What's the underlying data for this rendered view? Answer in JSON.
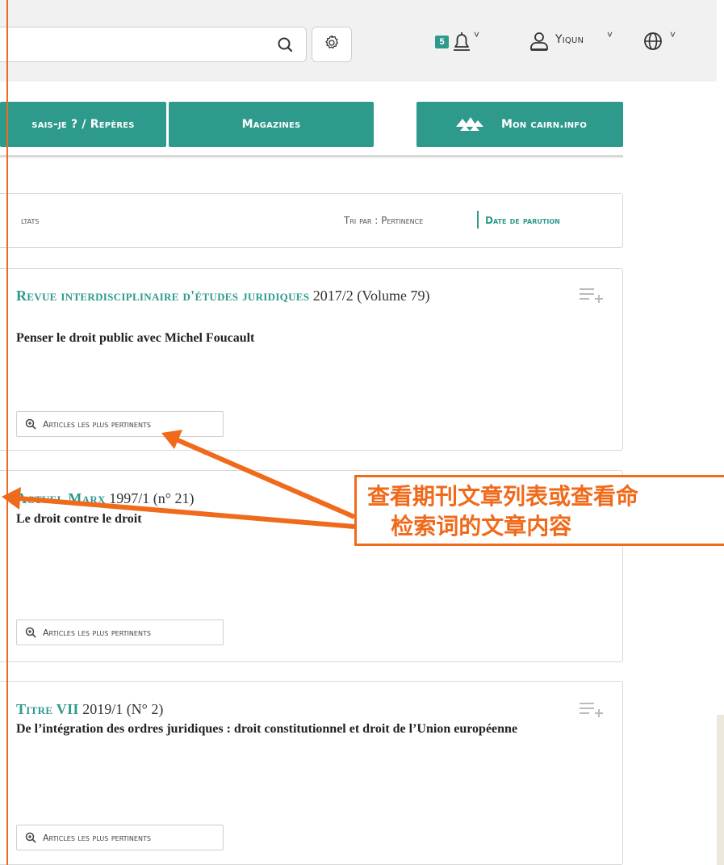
{
  "header": {
    "notification_count": "5",
    "user_name": "Yiqun"
  },
  "nav": {
    "btn1": "sais-je ? / Repères",
    "btn2": "Magazines",
    "btn3": "Mon cairn.info"
  },
  "results_bar": {
    "results_label": "ltats",
    "sort_prefix": "Tri par : Pertinence",
    "sort_date": "Date de parution"
  },
  "cards": [
    {
      "journal": "Revue interdisciplinaire d'études juridiques",
      "issue": "2017/2 (Volume 79)",
      "title": "Penser le droit public avec Michel Foucault",
      "button": "Articles les plus pertinents"
    },
    {
      "journal": "Actuel Marx",
      "issue": "1997/1 (n° 21)",
      "title": "Le droit contre le droit",
      "button": "Articles les plus pertinents"
    },
    {
      "journal": "Titre VII",
      "issue": "2019/1 (N° 2)",
      "title": "De l’intégration des ordres juridiques : droit constitutionnel et droit de l’Union européenne",
      "button": "Articles les plus pertinents"
    }
  ],
  "annotation": {
    "text": "查看期刊文章列表或查看命\n   检索词的文章内容",
    "color": "#f06a1b"
  },
  "colors": {
    "accent": "#2d9a8c",
    "annotation": "#f06a1b",
    "header_bg": "#f1f1f1"
  }
}
